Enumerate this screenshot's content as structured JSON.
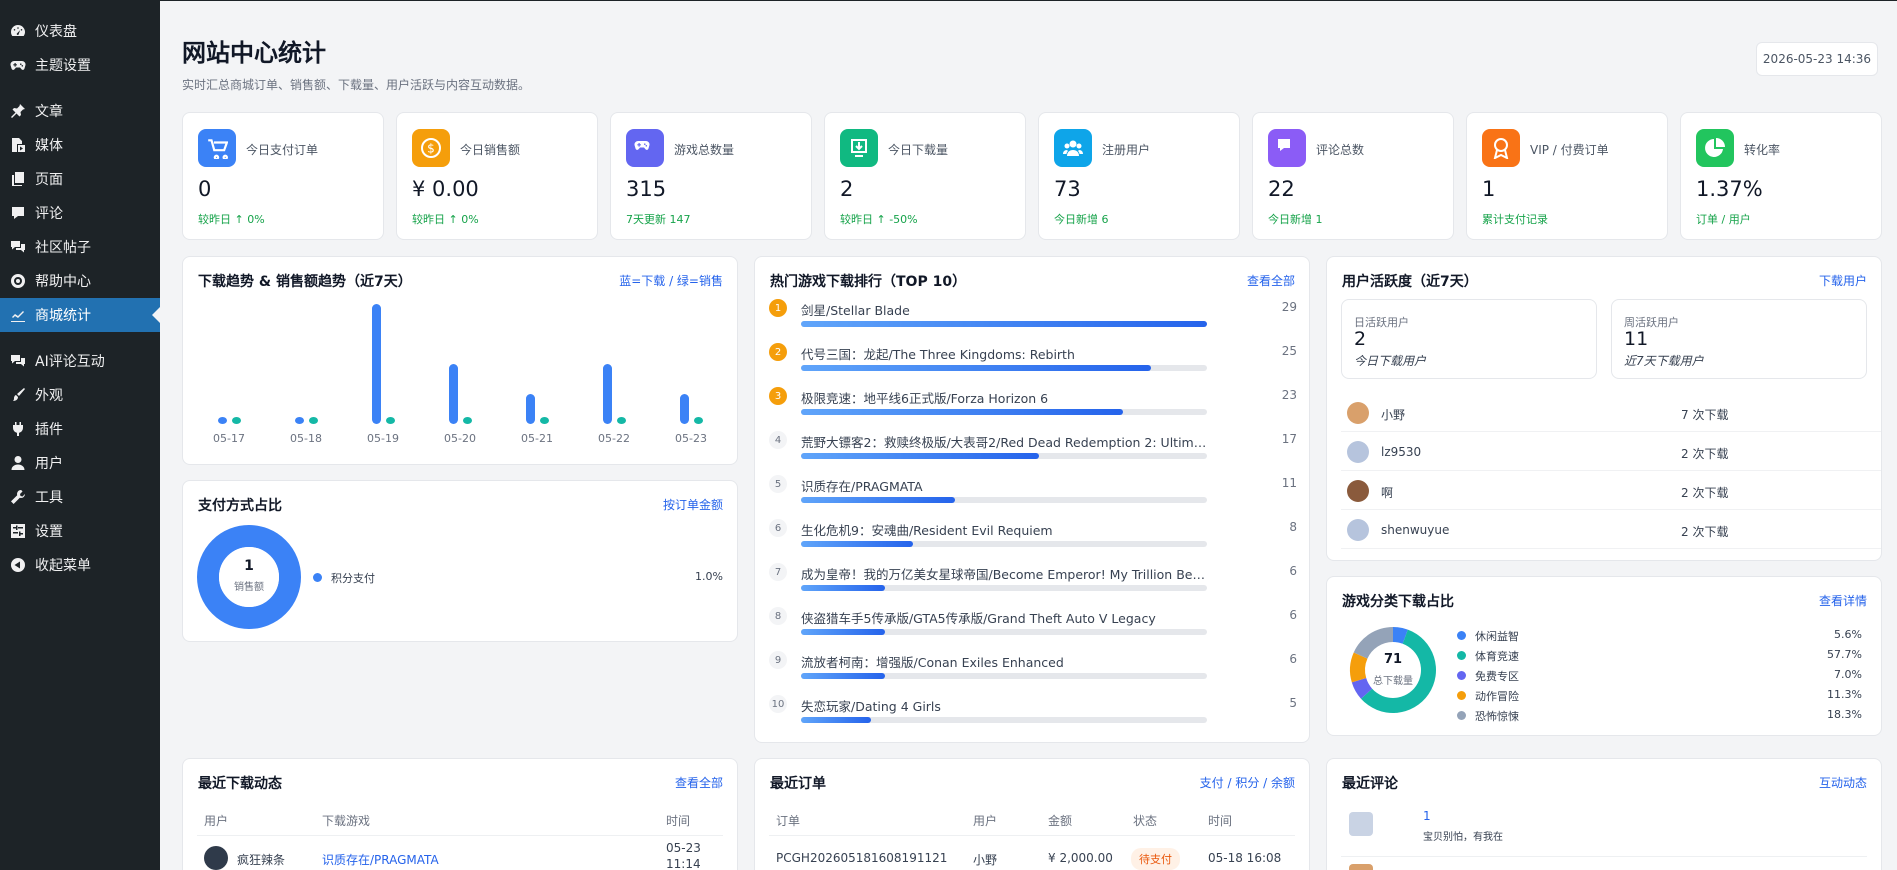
{
  "sidebar": {
    "items": [
      {
        "label": "仪表盘",
        "icon": "dashboard-icon"
      },
      {
        "label": "主题设置",
        "icon": "gamepad-icon"
      },
      {
        "label": "文章",
        "icon": "pin-icon"
      },
      {
        "label": "媒体",
        "icon": "media-icon"
      },
      {
        "label": "页面",
        "icon": "page-icon"
      },
      {
        "label": "评论",
        "icon": "comment-icon"
      },
      {
        "label": "社区帖子",
        "icon": "chat-icon"
      },
      {
        "label": "帮助中心",
        "icon": "help-icon"
      },
      {
        "label": "商城统计",
        "icon": "chart-icon",
        "active": true
      },
      {
        "label": "AI评论互动",
        "icon": "chat-icon"
      },
      {
        "label": "外观",
        "icon": "brush-icon"
      },
      {
        "label": "插件",
        "icon": "plugin-icon"
      },
      {
        "label": "用户",
        "icon": "user-icon"
      },
      {
        "label": "工具",
        "icon": "wrench-icon"
      },
      {
        "label": "设置",
        "icon": "settings-icon"
      },
      {
        "label": "收起菜单",
        "icon": "collapse-icon"
      }
    ]
  },
  "header": {
    "title": "网站中心统计",
    "subtitle": "实时汇总商城订单、销售额、下载量、用户活跃与内容互动数据。",
    "datetime": "2026-05-23 14:36"
  },
  "stats": [
    {
      "label": "今日支付订单",
      "value": "0",
      "foot": "较昨日 ↑ 0%",
      "color": "#3b82f6",
      "icon": "cart-icon"
    },
    {
      "label": "今日销售额",
      "value": "¥ 0.00",
      "foot": "较昨日 ↑ 0%",
      "color": "#f59e0b",
      "icon": "coin-icon"
    },
    {
      "label": "游戏总数量",
      "value": "315",
      "foot": "7天更新 147",
      "color": "#6366f1",
      "icon": "gamepad-icon"
    },
    {
      "label": "今日下载量",
      "value": "2",
      "foot": "较昨日 ↑ -50%",
      "color": "#10b981",
      "icon": "download-icon"
    },
    {
      "label": "注册用户",
      "value": "73",
      "foot": "今日新增 6",
      "color": "#0ea5e9",
      "icon": "users-icon"
    },
    {
      "label": "评论总数",
      "value": "22",
      "foot": "今日新增 1",
      "color": "#8b5cf6",
      "icon": "comment-icon"
    },
    {
      "label": "VIP / 付费订单",
      "value": "1",
      "foot": "累计支付记录",
      "color": "#f97316",
      "icon": "award-icon"
    },
    {
      "label": "转化率",
      "value": "1.37%",
      "foot": "订单 / 用户",
      "color": "#22c55e",
      "icon": "pie-icon"
    }
  ],
  "trend": {
    "title": "下载趋势 & 销售额趋势（近7天）",
    "legend_note": "蓝=下载 / 绿=销售"
  },
  "chart_data": {
    "type": "bar",
    "categories": [
      "05-17",
      "05-18",
      "05-19",
      "05-20",
      "05-21",
      "05-22",
      "05-23"
    ],
    "series": [
      {
        "values": [
          0,
          0,
          8,
          4,
          2,
          4,
          2
        ],
        "color": "#3b82f6"
      },
      {
        "values": [
          0,
          0,
          0,
          0,
          0,
          0,
          0
        ],
        "color": "#14b8a6"
      }
    ]
  },
  "payment": {
    "title": "支付方式占比",
    "link": "按订单金额",
    "center_value": "1",
    "center_label": "销售额",
    "items": [
      {
        "name": "积分支付",
        "pct": "1.0%",
        "color": "#3b82f6"
      }
    ]
  },
  "ranking": {
    "title": "热门游戏下载排行（TOP 10）",
    "link": "查看全部",
    "items": [
      {
        "rank": "1",
        "name": "剑星/Stellar Blade",
        "count": "29"
      },
      {
        "rank": "2",
        "name": "代号三国：龙起/The Three Kingdoms: Rebirth",
        "count": "25"
      },
      {
        "rank": "3",
        "name": "极限竞速：地平线6正式版/Forza Horizon 6",
        "count": "23"
      },
      {
        "rank": "4",
        "name": "荒野大镖客2：救赎终极版/大表哥2/Red Dead Redemption 2: Ultimat...",
        "count": "17"
      },
      {
        "rank": "5",
        "name": "识质存在/PRAGMATA",
        "count": "11"
      },
      {
        "rank": "6",
        "name": "生化危机9：安魂曲/Resident Evil Requiem",
        "count": "8"
      },
      {
        "rank": "7",
        "name": "成为皇帝！我的万亿美女星球帝国/Become Emperor! My Trillion Beau...",
        "count": "6"
      },
      {
        "rank": "8",
        "name": "侠盗猎车手5传承版/GTA5传承版/Grand Theft Auto V Legacy",
        "count": "6"
      },
      {
        "rank": "9",
        "name": "流放者柯南：增强版/Conan Exiles Enhanced",
        "count": "6"
      },
      {
        "rank": "10",
        "name": "失恋玩家/Dating 4 Girls",
        "count": "5"
      }
    ]
  },
  "activity": {
    "title": "用户活跃度（近7天）",
    "link": "下载用户",
    "dau_label": "日活跃用户",
    "dau_value": "2",
    "dau_sub": "今日下载用户",
    "wau_label": "周活跃用户",
    "wau_value": "11",
    "wau_sub": "近7天下载用户",
    "users": [
      {
        "name": "小野",
        "count": "7 次下载",
        "color": "#d9a06b"
      },
      {
        "name": "lz9530",
        "count": "2 次下载",
        "color": "#b6c4dd"
      },
      {
        "name": "啊",
        "count": "2 次下载",
        "color": "#8a5a3c"
      },
      {
        "name": "shenwuyue",
        "count": "2 次下载",
        "color": "#b6c4dd"
      }
    ]
  },
  "category": {
    "title": "游戏分类下载占比",
    "link": "查看详情",
    "center_value": "71",
    "center_label": "总下载量",
    "items": [
      {
        "name": "休闲益智",
        "pct": "5.6%",
        "value": 5.6,
        "color": "#3b82f6"
      },
      {
        "name": "体育竞速",
        "pct": "57.7%",
        "value": 57.7,
        "color": "#14b8a6"
      },
      {
        "name": "免费专区",
        "pct": "7.0%",
        "value": 7.0,
        "color": "#6366f1"
      },
      {
        "name": "动作冒险",
        "pct": "11.3%",
        "value": 11.3,
        "color": "#f59e0b"
      },
      {
        "name": "恐怖惊悚",
        "pct": "18.3%",
        "value": 18.3,
        "color": "#94a3b8"
      }
    ]
  },
  "recent_downloads": {
    "title": "最近下载动态",
    "link": "查看全部",
    "col_user": "用户",
    "col_game": "下载游戏",
    "col_time": "时间",
    "rows": [
      {
        "user": "疯狂辣条",
        "game": "识质存在/PRAGMATA",
        "date": "05-23",
        "time": "11:14"
      }
    ]
  },
  "recent_orders": {
    "title": "最近订单",
    "link": "支付 / 积分 / 余额",
    "cols": [
      "订单",
      "用户",
      "金额",
      "状态",
      "时间"
    ],
    "rows": [
      {
        "id": "PCGH202605181608191121",
        "user": "小野",
        "amount": "¥ 2,000.00",
        "status": "待支付",
        "time": "05-18 16:08"
      }
    ]
  },
  "recent_comments": {
    "title": "最近评论",
    "link": "互动动态",
    "rows": [
      {
        "text": "1",
        "sub": "宝贝别怕，有我在"
      }
    ]
  }
}
